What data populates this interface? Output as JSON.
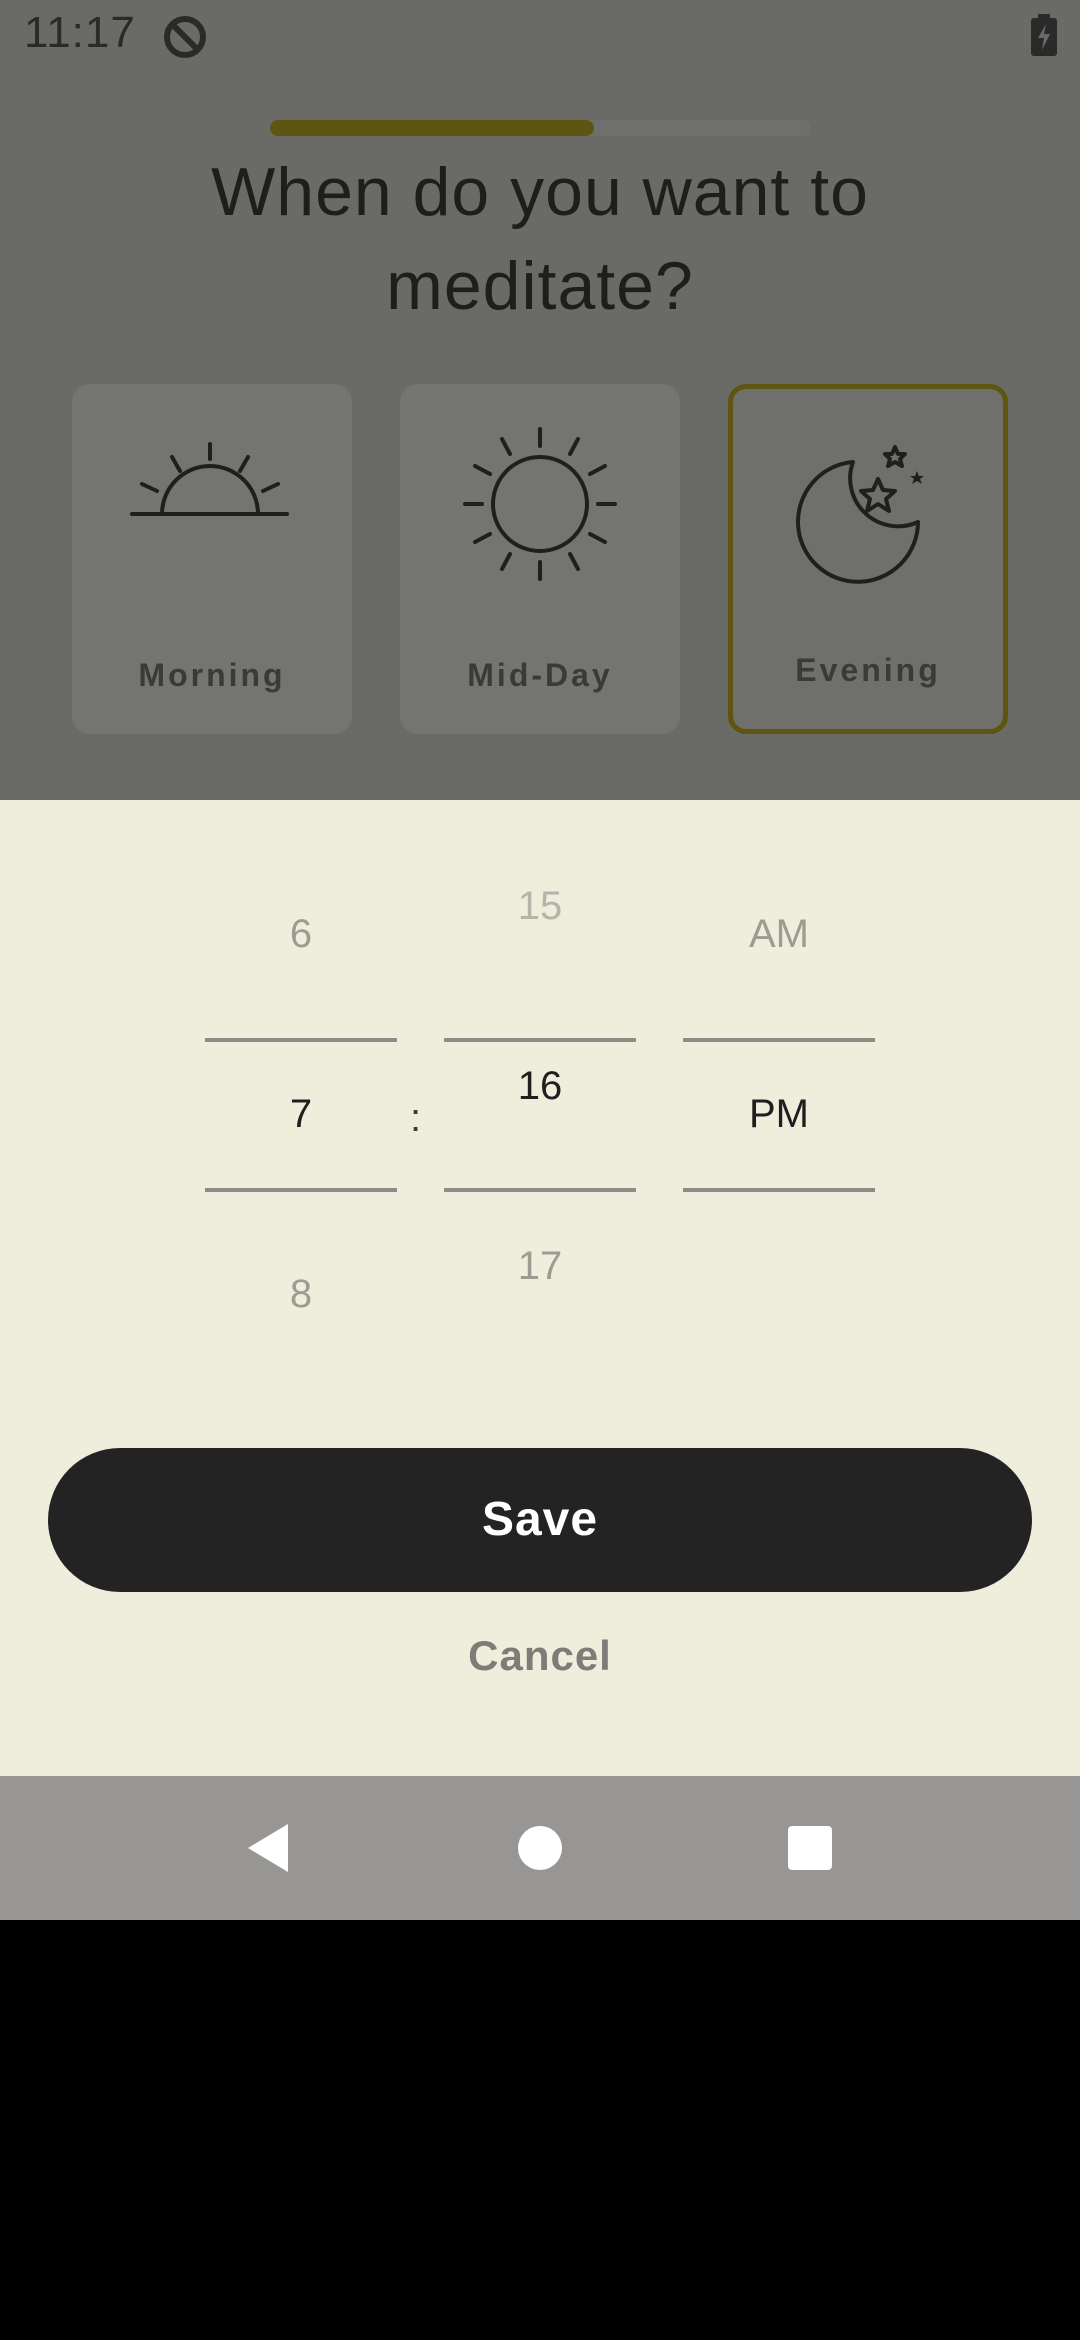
{
  "status_bar": {
    "time": "11:17",
    "app_icon": "no-disturb-icon",
    "battery_icon": "battery-charging-icon"
  },
  "onboarding": {
    "progress": 0.6,
    "question": "When do you want to meditate?"
  },
  "time_options": [
    {
      "label": "Morning",
      "icon": "sunrise-icon",
      "selected": false
    },
    {
      "label": "Mid-Day",
      "icon": "sun-icon",
      "selected": false
    },
    {
      "label": "Evening",
      "icon": "moon-stars-icon",
      "selected": true
    }
  ],
  "time_picker": {
    "hour": {
      "above": "6",
      "current": "7",
      "below": "8"
    },
    "separator": ":",
    "minute": {
      "above": "15",
      "current": "16",
      "below": "17"
    },
    "period": {
      "above": "AM",
      "current": "PM"
    }
  },
  "actions": {
    "save_label": "Save",
    "cancel_label": "Cancel"
  },
  "nav_bar": {
    "back_icon": "back-triangle-icon",
    "home_icon": "home-circle-icon",
    "recents_icon": "recents-square-icon"
  },
  "colors": {
    "accent": "#5f5510",
    "sheet_background": "#efeddc",
    "primary_button": "#232323"
  }
}
